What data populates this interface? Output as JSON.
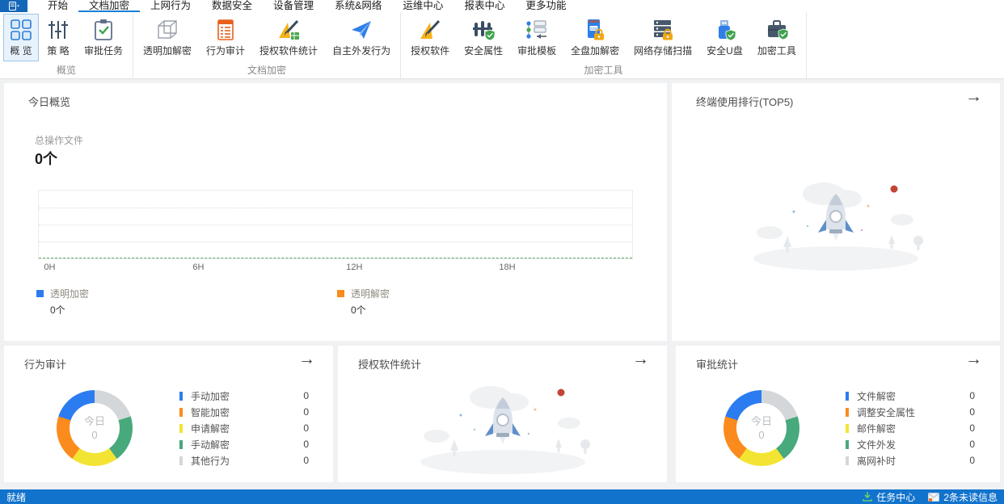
{
  "titlebar": {
    "tabs": [
      {
        "label": "开始"
      },
      {
        "label": "文档加密"
      },
      {
        "label": "上网行为"
      },
      {
        "label": "数据安全"
      },
      {
        "label": "设备管理"
      },
      {
        "label": "系统&网络"
      },
      {
        "label": "运维中心"
      },
      {
        "label": "报表中心"
      },
      {
        "label": "更多功能"
      }
    ],
    "active_tab": "文档加密"
  },
  "ribbon": {
    "groups": [
      {
        "label": "概览",
        "items": [
          {
            "label": "概 览",
            "icon": "overview-grid-icon",
            "active": true
          },
          {
            "label": "策 略",
            "icon": "policy-sliders-icon"
          },
          {
            "label": "审批任务",
            "icon": "approval-clipboard-icon"
          }
        ]
      },
      {
        "label": "文档加密",
        "items": [
          {
            "label": "透明加解密",
            "icon": "cube-icon"
          },
          {
            "label": "行为审计",
            "icon": "audit-list-icon"
          },
          {
            "label": "授权软件统计",
            "icon": "setsquare-pencil-chart-icon"
          },
          {
            "label": "自主外发行为",
            "icon": "paper-plane-icon"
          }
        ]
      },
      {
        "label": "加密工具",
        "items": [
          {
            "label": "授权软件",
            "icon": "setsquare-pencil-icon"
          },
          {
            "label": "安全属性",
            "icon": "fence-shield-icon"
          },
          {
            "label": "审批模板",
            "icon": "flow-template-icon"
          },
          {
            "label": "全盘加解密",
            "icon": "ssd-lock-icon"
          },
          {
            "label": "网络存储扫描",
            "icon": "server-lock-icon"
          },
          {
            "label": "安全U盘",
            "icon": "usb-shield-icon"
          },
          {
            "label": "加密工具",
            "icon": "briefcase-shield-icon"
          }
        ]
      }
    ]
  },
  "cards": {
    "today_overview": {
      "title": "今日概览",
      "stat_label": "总操作文件",
      "stat_value": "0个"
    },
    "terminal_ranking": {
      "title": "终端使用排行(TOP5)"
    },
    "behavior_audit": {
      "title": "行为审计"
    },
    "software_stats": {
      "title": "授权软件统计"
    },
    "approval_stats": {
      "title": "审批统计"
    }
  },
  "chart_data": [
    {
      "id": "today_operations_line",
      "type": "line",
      "title": "今日概览 总操作文件",
      "x_ticks": [
        "0H",
        "6H",
        "12H",
        "18H"
      ],
      "x_range_hours": [
        0,
        24
      ],
      "grid": "dotted-horizontal",
      "legend_position": "bottom",
      "series": [
        {
          "name": "透明加密",
          "color": "#2b7cf0",
          "display_value": "0个",
          "values": [
            0,
            0,
            0,
            0,
            0
          ]
        },
        {
          "name": "透明解密",
          "color": "#fb8b1d",
          "display_value": "0个",
          "values": [
            0,
            0,
            0,
            0,
            0
          ]
        }
      ]
    },
    {
      "id": "behavior_audit_donut",
      "type": "pie",
      "title": "行为审计",
      "center_label": "今日",
      "center_value": "0",
      "slices": [
        {
          "label": "手动加密",
          "value": 0,
          "color": "#2b7cf0"
        },
        {
          "label": "智能加密",
          "value": 0,
          "color": "#fb8b1d"
        },
        {
          "label": "申请解密",
          "value": 0,
          "color": "#f3e434"
        },
        {
          "label": "手动解密",
          "value": 0,
          "color": "#47a97c"
        },
        {
          "label": "其他行为",
          "value": 0,
          "color": "#d4d7da"
        }
      ]
    },
    {
      "id": "approval_stats_donut",
      "type": "pie",
      "title": "审批统计",
      "center_label": "今日",
      "center_value": "0",
      "slices": [
        {
          "label": "文件解密",
          "value": 0,
          "color": "#2b7cf0"
        },
        {
          "label": "调整安全属性",
          "value": 0,
          "color": "#fb8b1d"
        },
        {
          "label": "邮件解密",
          "value": 0,
          "color": "#f3e434"
        },
        {
          "label": "文件外发",
          "value": 0,
          "color": "#47a97c"
        },
        {
          "label": "离网补时",
          "value": 0,
          "color": "#d4d7da"
        }
      ]
    }
  ],
  "statusbar": {
    "ready": "就绪",
    "task_center": "任务中心",
    "unread": "2条未读信息"
  }
}
